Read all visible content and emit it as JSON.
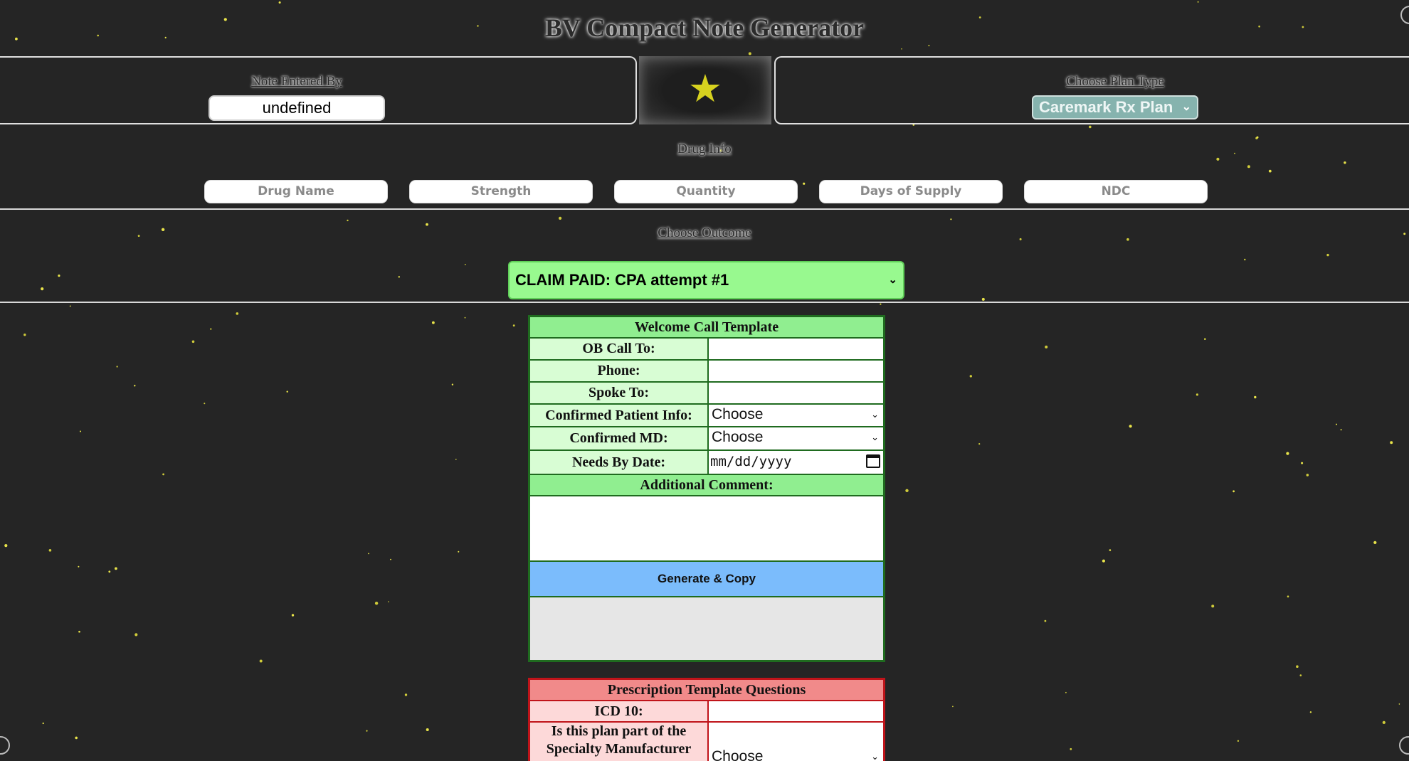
{
  "title": "BV Compact Note Generator",
  "header": {
    "note_entered_by_label": "Note Entered By",
    "note_entered_by_value": "undefined",
    "plan_type_label": "Choose Plan Type",
    "plan_type_value": "Caremark Rx Plan",
    "star_icon": "star-icon"
  },
  "drug_info": {
    "label": "Drug Info",
    "fields": [
      {
        "placeholder": "Drug Name"
      },
      {
        "placeholder": "Strength"
      },
      {
        "placeholder": "Quantity"
      },
      {
        "placeholder": "Days of Supply"
      },
      {
        "placeholder": "NDC"
      }
    ]
  },
  "outcome": {
    "label": "Choose Outcome",
    "value": "CLAIM PAID: CPA attempt #1"
  },
  "welcome_template": {
    "title": "Welcome Call Template",
    "ob_call_to_label": "OB Call To:",
    "phone_label": "Phone:",
    "spoke_to_label": "Spoke To:",
    "confirmed_patient_info_label": "Confirmed Patient Info:",
    "confirmed_patient_info_value": "Choose",
    "confirmed_md_label": "Confirmed MD:",
    "confirmed_md_value": "Choose",
    "needs_by_date_label": "Needs By Date:",
    "needs_by_date_placeholder": "mm/dd/yyyy",
    "additional_comment_label": "Additional Comment:",
    "generate_button": "Generate & Copy"
  },
  "prescription_template": {
    "title": "Prescription Template Questions",
    "icd10_label": "ICD 10:",
    "specialty_question_line1": "Is this plan part of the",
    "specialty_question_line2": "Specialty Manufacturer",
    "specialty_value": "Choose"
  },
  "colors": {
    "background": "#252525",
    "outcome_green": "#98f98f",
    "template_green": "#90ee90",
    "generate_blue": "#7bbcfc",
    "prescription_red": "#f18a8a",
    "star_yellow": "#d7d21f"
  }
}
